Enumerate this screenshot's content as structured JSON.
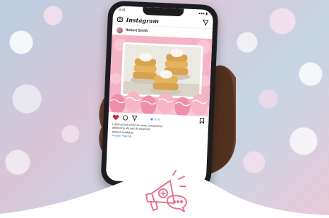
{
  "app": {
    "title": "Instagram",
    "status_time": "9:41",
    "status_signal": "●●● ▮"
  },
  "post": {
    "username": "Robert Smith",
    "caption_line1": "Lorem ipsum dolor sit amet, consectetur",
    "caption_line2": "adipiscing elit sed do eiusmod",
    "caption_line3": "tempor incididunt",
    "caption_link": "#easter #spring",
    "carousel_count": 3,
    "carousel_active": 1
  },
  "colors": {
    "accent_pink": "#e8748f",
    "post_bg": "#f4b3c6",
    "like_red": "#d6233c",
    "wave": "#ffffff"
  },
  "icons": [
    "camera-icon",
    "send-icon",
    "heart-icon",
    "comment-icon",
    "share-icon",
    "bookmark-icon",
    "megaphone-icon"
  ]
}
